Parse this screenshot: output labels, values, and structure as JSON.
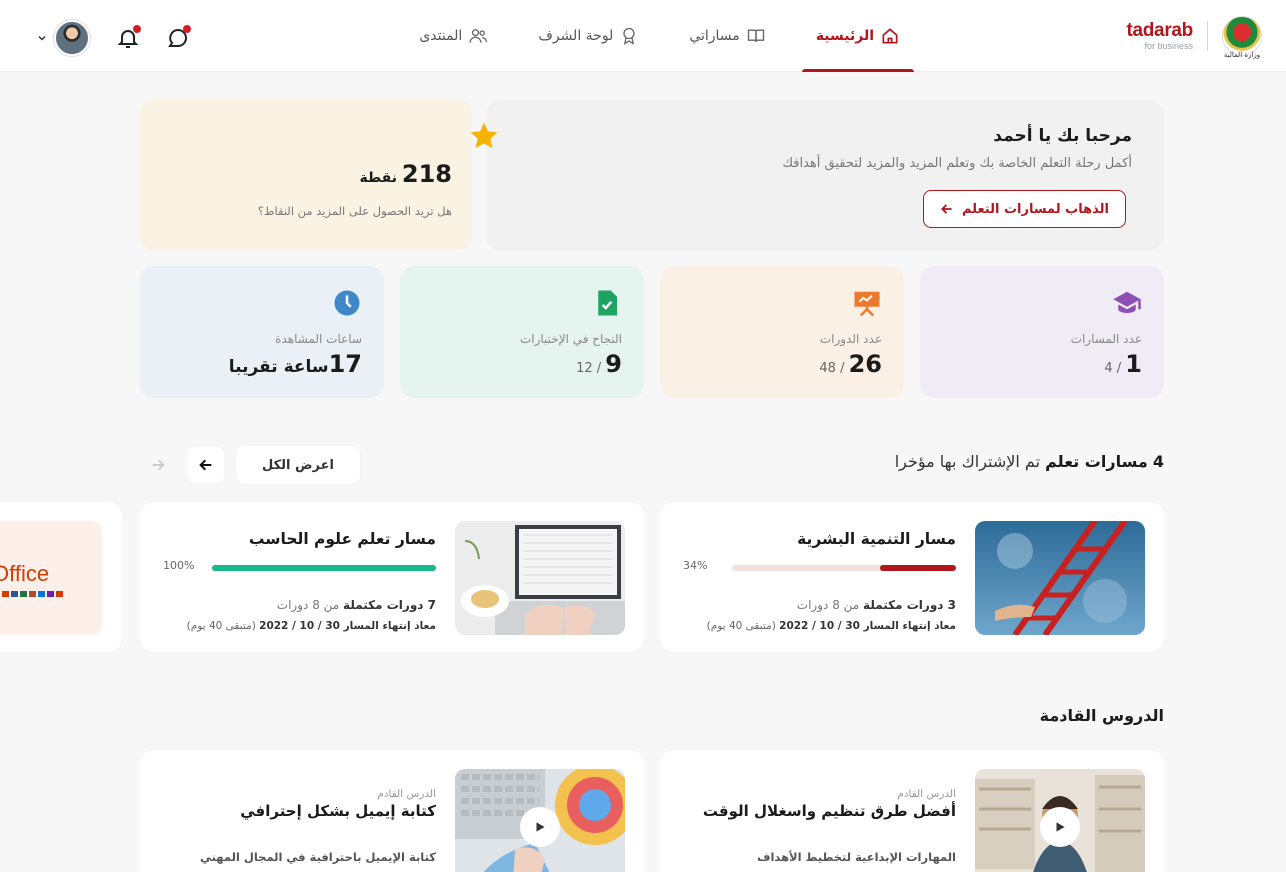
{
  "header": {
    "emblem_caption": "وزارة المالية",
    "brand_name": "tadarab",
    "brand_sub": "for business",
    "nav": [
      {
        "label": "الرئيسية",
        "icon": "home-icon",
        "active": true
      },
      {
        "label": "مساراتي",
        "icon": "book-icon",
        "active": false
      },
      {
        "label": "لوحة الشرف",
        "icon": "award-icon",
        "active": false
      },
      {
        "label": "المنتدى",
        "icon": "users-icon",
        "active": false
      }
    ]
  },
  "welcome": {
    "title": "مرحبا بك يا أحمد",
    "subtitle": "أكمل رحلة التعلم الخاصة بك وتعلم المزيد والمزيد لتحقيق أهدافك",
    "button": "الذهاب لمسارات التعلم"
  },
  "points": {
    "value": "218",
    "unit": "نقطة",
    "question": "هل تريد الحصول على المزيد من النقاط؟"
  },
  "stats": [
    {
      "label": "عدد المسارات",
      "value": "1",
      "total": "/ 4",
      "icon": "graduation-cap-icon",
      "color": "#8e4fb7"
    },
    {
      "label": "عدد الدورات",
      "value": "26",
      "total": "/ 48",
      "icon": "presentation-board-icon",
      "color": "#ec7a2c"
    },
    {
      "label": "النجاح في الإختبارات",
      "value": "9",
      "total": "/ 12",
      "icon": "file-check-icon",
      "color": "#1fa362"
    },
    {
      "label": "ساعات المشاهدة",
      "value": "17",
      "total": "ساعة تقريبا",
      "icon": "clock-icon",
      "color": "#3f88c7"
    }
  ],
  "paths_section": {
    "count": "4",
    "bold": "مسارات تعلم",
    "rest": "تم الإشتراك بها مؤخرا",
    "view_all": "اعرض الكل"
  },
  "path_cards": [
    {
      "title": "مسار التنمية البشرية",
      "percent": "34%",
      "progress": 0.34,
      "bar_color": "#b1161c",
      "completed_bold": "3 دورات مكتملة",
      "completed_rest": "من 8 دورات",
      "date_bold": "معاد إنتهاء المسار 30 / 10 / 2022",
      "date_rest": "(متبقى 40 يوم)"
    },
    {
      "title": "مسار تعلم علوم الحاسب",
      "percent": "100%",
      "progress": 1.0,
      "bar_color": "#18b88a",
      "completed_bold": "7 دورات مكتملة",
      "completed_rest": "من 8 دورات",
      "date_bold": "معاد إنتهاء المسار 30 / 10 / 2022",
      "date_rest": "(متبقى 40 يوم)"
    }
  ],
  "partial_card": {
    "logo_text": "Office"
  },
  "upcoming": {
    "title": "الدروس القادمة",
    "lessons": [
      {
        "small": "الدرس القادم",
        "title": "أفضل طرق تنظيم واسغلال الوقت",
        "desc": "المهارات الإبداعية لتخطيط الأهداف"
      },
      {
        "small": "الدرس القادم",
        "title": "كتابة إيميل بشكل إحترافي",
        "desc": "كتابة الإيميل باحترافية في المجال المهني"
      }
    ]
  }
}
